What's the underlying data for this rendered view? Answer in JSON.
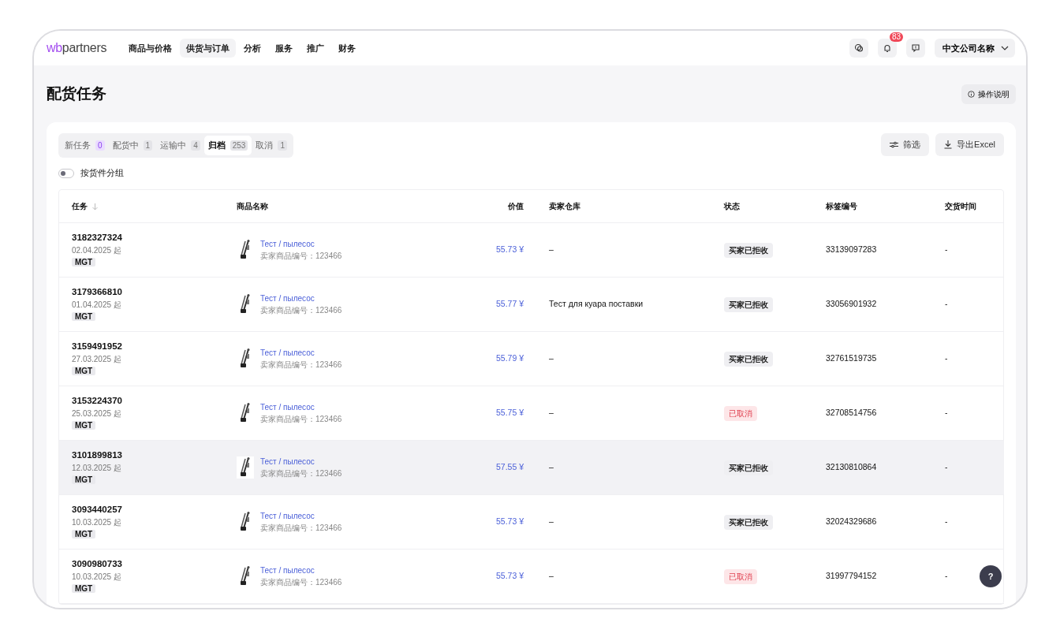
{
  "logo": {
    "brand_a": "wb",
    "brand_b": "partners"
  },
  "nav": [
    {
      "label": "商品与价格",
      "selected": false
    },
    {
      "label": "供货与订单",
      "selected": true
    },
    {
      "label": "分析",
      "selected": false
    },
    {
      "label": "服务",
      "selected": false
    },
    {
      "label": "推广",
      "selected": false
    },
    {
      "label": "财务",
      "selected": false
    }
  ],
  "header_actions": {
    "notification_count": "83",
    "company": "中文公司名称"
  },
  "page_title": "配货任务",
  "help_button": "操作说明",
  "tabs": [
    {
      "label": "新任务",
      "count": "0",
      "selected": false,
      "highlight_count": true
    },
    {
      "label": "配货中",
      "count": "1",
      "selected": false,
      "highlight_count": false
    },
    {
      "label": "运输中",
      "count": "4",
      "selected": false,
      "highlight_count": false
    },
    {
      "label": "归档",
      "count": "253",
      "selected": true,
      "highlight_count": false
    },
    {
      "label": "取消",
      "count": "1",
      "selected": false,
      "highlight_count": false
    }
  ],
  "filter_button": "筛选",
  "export_button": "导出Excel",
  "group_toggle": {
    "label": "按货件分组",
    "on": false
  },
  "table": {
    "columns": [
      "任务",
      "商品名称",
      "价值",
      "卖家仓库",
      "状态",
      "标签编号",
      "交货时间"
    ],
    "rows": [
      {
        "id": "3182327324",
        "date": "02.04.2025 起",
        "tag": "MGT",
        "product": "Тест / пылесос",
        "sku": "卖家商品编号：123466",
        "price": "55.73 ¥",
        "warehouse": "–",
        "status": {
          "text": "买家已拒收",
          "kind": "rejected"
        },
        "label_no": "33139097283",
        "delivery": "-",
        "highlighted": false
      },
      {
        "id": "3179366810",
        "date": "01.04.2025 起",
        "tag": "MGT",
        "product": "Тест / пылесос",
        "sku": "卖家商品编号：123466",
        "price": "55.77 ¥",
        "warehouse": "Тест для куара поставки",
        "status": {
          "text": "买家已拒收",
          "kind": "rejected"
        },
        "label_no": "33056901932",
        "delivery": "-",
        "highlighted": false
      },
      {
        "id": "3159491952",
        "date": "27.03.2025 起",
        "tag": "MGT",
        "product": "Тест / пылесос",
        "sku": "卖家商品编号：123466",
        "price": "55.79 ¥",
        "warehouse": "–",
        "status": {
          "text": "买家已拒收",
          "kind": "rejected"
        },
        "label_no": "32761519735",
        "delivery": "-",
        "highlighted": false
      },
      {
        "id": "3153224370",
        "date": "25.03.2025 起",
        "tag": "MGT",
        "product": "Тест / пылесос",
        "sku": "卖家商品编号：123466",
        "price": "55.75 ¥",
        "warehouse": "–",
        "status": {
          "text": "已取消",
          "kind": "cancelled"
        },
        "label_no": "32708514756",
        "delivery": "-",
        "highlighted": false
      },
      {
        "id": "3101899813",
        "date": "12.03.2025 起",
        "tag": "MGT",
        "product": "Тест / пылесос",
        "sku": "卖家商品编号：123466",
        "price": "57.55 ¥",
        "warehouse": "–",
        "status": {
          "text": "买家已拒收",
          "kind": "rejected"
        },
        "label_no": "32130810864",
        "delivery": "-",
        "highlighted": true
      },
      {
        "id": "3093440257",
        "date": "10.03.2025 起",
        "tag": "MGT",
        "product": "Тест / пылесос",
        "sku": "卖家商品编号：123466",
        "price": "55.73 ¥",
        "warehouse": "–",
        "status": {
          "text": "买家已拒收",
          "kind": "rejected"
        },
        "label_no": "32024329686",
        "delivery": "-",
        "highlighted": false
      },
      {
        "id": "3090980733",
        "date": "10.03.2025 起",
        "tag": "MGT",
        "product": "Тест / пылесос",
        "sku": "卖家商品编号：123466",
        "price": "55.73 ¥",
        "warehouse": "–",
        "status": {
          "text": "已取消",
          "kind": "cancelled"
        },
        "label_no": "31997794152",
        "delivery": "-",
        "highlighted": false
      }
    ]
  },
  "help_fab": "?"
}
